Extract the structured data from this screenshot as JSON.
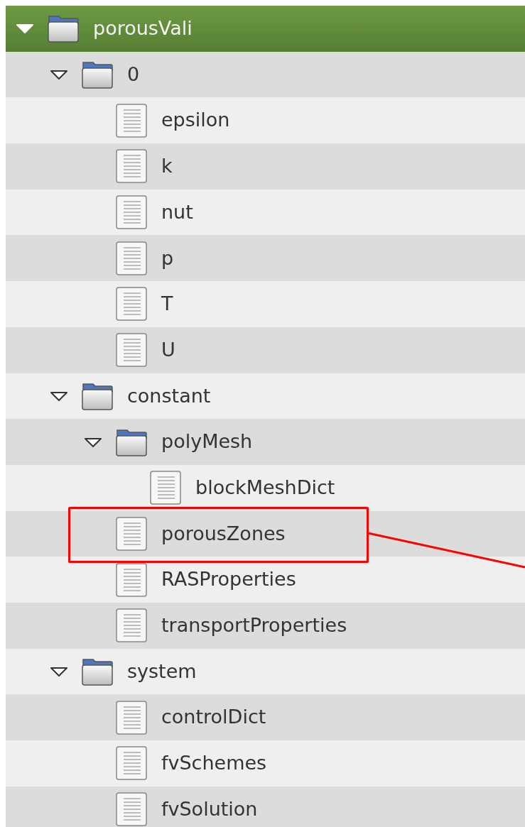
{
  "tree": [
    {
      "kind": "folder",
      "name": "porousVali",
      "expanded": true,
      "selected": true,
      "annotated": false,
      "children": [
        {
          "kind": "folder",
          "name": "0",
          "expanded": true,
          "selected": false,
          "annotated": false,
          "children": [
            {
              "kind": "file",
              "name": "epsilon",
              "selected": false,
              "annotated": false
            },
            {
              "kind": "file",
              "name": "k",
              "selected": false,
              "annotated": false
            },
            {
              "kind": "file",
              "name": "nut",
              "selected": false,
              "annotated": false
            },
            {
              "kind": "file",
              "name": "p",
              "selected": false,
              "annotated": false
            },
            {
              "kind": "file",
              "name": "T",
              "selected": false,
              "annotated": false
            },
            {
              "kind": "file",
              "name": "U",
              "selected": false,
              "annotated": false
            }
          ]
        },
        {
          "kind": "folder",
          "name": "constant",
          "expanded": true,
          "selected": false,
          "annotated": false,
          "children": [
            {
              "kind": "folder",
              "name": "polyMesh",
              "expanded": true,
              "selected": false,
              "annotated": false,
              "children": [
                {
                  "kind": "file",
                  "name": "blockMeshDict",
                  "selected": false,
                  "annotated": false
                }
              ]
            },
            {
              "kind": "file",
              "name": "porousZones",
              "selected": false,
              "annotated": true
            },
            {
              "kind": "file",
              "name": "RASProperties",
              "selected": false,
              "annotated": false
            },
            {
              "kind": "file",
              "name": "transportProperties",
              "selected": false,
              "annotated": false
            }
          ]
        },
        {
          "kind": "folder",
          "name": "system",
          "expanded": true,
          "selected": false,
          "annotated": false,
          "children": [
            {
              "kind": "file",
              "name": "controlDict",
              "selected": false,
              "annotated": false
            },
            {
              "kind": "file",
              "name": "fvSchemes",
              "selected": false,
              "annotated": false
            },
            {
              "kind": "file",
              "name": "fvSolution",
              "selected": false,
              "annotated": false
            }
          ]
        }
      ]
    }
  ]
}
